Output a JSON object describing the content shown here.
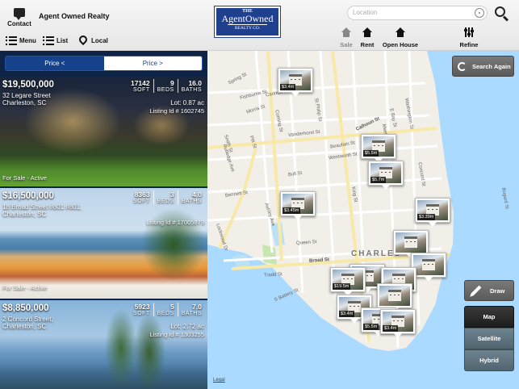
{
  "header": {
    "contact_label": "Contact",
    "brand_name": "Agent Owned Realty",
    "logo": {
      "line1": "THE",
      "line2": "AgentOwned",
      "line3": "REALTY CO."
    },
    "nav": {
      "menu_label": "Menu",
      "list_label": "List",
      "local_label": "Local"
    },
    "search": {
      "placeholder": "Location",
      "value": ""
    },
    "tools": {
      "sale_label": "Sale",
      "rent_label": "Rent",
      "open_house_label": "Open House",
      "refine_label": "Refine"
    }
  },
  "sort": {
    "ascending_label": "Price <",
    "descending_label": "Price >"
  },
  "listings": [
    {
      "price": "$19,500,000",
      "address_line1": "32 Legare Street",
      "address_line2": "Charleston, SC",
      "sqft": "17142",
      "sqft_label": "SOFT",
      "beds": "9",
      "beds_label": "BEDS",
      "baths": "16.0",
      "baths_label": "BATHS",
      "lot": "Lot: 0.87 ac",
      "listing_id": "Listing Id # 1602745",
      "status": "For Sale - Active"
    },
    {
      "price": "$16,500,000",
      "address_line1": "18 Broad Street #801 #801,",
      "address_line2": "Charleston, SC",
      "sqft": "8363",
      "sqft_label": "SOFT",
      "beds": "3",
      "beds_label": "BEDS",
      "baths": "4.0",
      "baths_label": "BATHS",
      "lot": "",
      "listing_id": "Listing Id # 17005879",
      "status": "For Sale - Active"
    },
    {
      "price": "$8,850,000",
      "address_line1": "2 Concord Street,",
      "address_line2": "Charleston, SC",
      "sqft": "5923",
      "sqft_label": "SOFT",
      "beds": "5",
      "beds_label": "BEDS",
      "baths": "7.0",
      "baths_label": "BATHS",
      "lot": "Lot: 2.72 ac",
      "listing_id": "Listing Id # 1303255",
      "status": ""
    }
  ],
  "map": {
    "search_again_label": "Search Again",
    "draw_label": "Draw",
    "map_type_options": [
      "Map",
      "Satellite",
      "Hybrid"
    ],
    "map_type_selected": "Map",
    "legal_label": "Legal",
    "city_label": "CHARLES",
    "street_labels": {
      "spring": "Spring St",
      "morris": "Morris St",
      "coming": "Coming St",
      "cannon": "Cannon St",
      "vanderhorst": "Vanderhorst St",
      "calhoun": "Calhoun St",
      "bull": "Bull St",
      "wentworth": "Wentworth St",
      "beaufain": "Beaufain St",
      "king": "King St",
      "meeting": "Meeting St",
      "rutledge": "Rutledge Ave",
      "ashley": "Ashley Ave",
      "broad": "Broad St",
      "queen": "Queen St",
      "battery": "S Battery St",
      "bay": "E Bay St",
      "washington": "Washington St",
      "lockwood": "Lockwood Dr",
      "tradd": "Tradd St",
      "bennett": "Bennett St",
      "smith": "Smith St",
      "pitt": "Pitt St",
      "fishburne": "Fishburne St",
      "concord": "Concord St",
      "st_philip": "St Philip St",
      "bogard": "Bogard St"
    },
    "markers": [
      {
        "price": "$3.4m"
      },
      {
        "price": "$5.5m"
      },
      {
        "price": "$5.7m"
      },
      {
        "price": "$3.45m"
      },
      {
        "price": "$3.39m"
      },
      {
        "price": "$19.5m"
      },
      {
        "price": "$3.4m"
      },
      {
        "price": "$5.5m"
      },
      {
        "price": "$3.4m"
      }
    ]
  }
}
